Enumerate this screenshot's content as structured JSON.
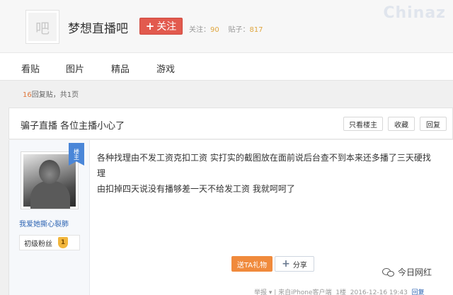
{
  "header": {
    "forum_name": "梦想直播吧",
    "logo_glyph": "吧",
    "follow_label": "关注",
    "follow_plus": "+",
    "stats_follow_label": "关注：",
    "stats_follow_count": "90",
    "stats_posts_label": "贴子：",
    "stats_posts_count": "817",
    "watermark_top": "Chinaz"
  },
  "nav": {
    "items": [
      {
        "label": "看贴"
      },
      {
        "label": "图片"
      },
      {
        "label": "精品"
      },
      {
        "label": "游戏"
      }
    ]
  },
  "reply_info": {
    "count": "16",
    "suffix": "回复贴，共1页"
  },
  "thread": {
    "title": "骗子直播 各位主播小心了",
    "buttons": {
      "only_op": "只看楼主",
      "favorite": "收藏",
      "reply": "回复"
    }
  },
  "post": {
    "author": {
      "ribbon": "楼主",
      "username": "我爱她撕心裂肺",
      "level_name": "初级粉丝",
      "level_num": "1"
    },
    "content_line1": "各种找理由不发工资克扣工资 实打实的截图放在面前说后台查不到本来还多播了三天硬找理",
    "content_line2": "由扣掉四天说没有播够差一天不给发工资 我就呵呵了",
    "gift_label": "送TA礼物",
    "share_label": "分享",
    "share_plus": "+",
    "footer_report": "举报",
    "footer_from": "| 来自iPhone客户端",
    "footer_floor": "1楼",
    "footer_time": "2016-12-16 19:43",
    "footer_reply": "回复"
  },
  "watermark_bottom": "今日网红",
  "colors": {
    "follow_button": "#e25a4e",
    "link_blue": "#2d64b3",
    "gift_orange": "#f08a3c",
    "count_orange": "#e0773d",
    "stat_orange": "#e0a640"
  }
}
